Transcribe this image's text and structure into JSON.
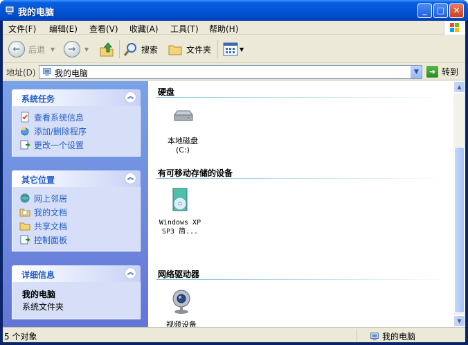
{
  "window": {
    "title": "我的电脑"
  },
  "menu": [
    "文件(F)",
    "编辑(E)",
    "查看(V)",
    "收藏(A)",
    "工具(T)",
    "帮助(H)"
  ],
  "toolbar": {
    "back_label": "后退",
    "search_label": "搜索",
    "folders_label": "文件夹"
  },
  "address": {
    "label": "地址(D)",
    "value": "我的电脑",
    "go_label": "转到"
  },
  "sidebar": {
    "system_tasks": {
      "title": "系统任务",
      "items": [
        "查看系统信息",
        "添加/删除程序",
        "更改一个设置"
      ]
    },
    "other_places": {
      "title": "其它位置",
      "items": [
        "网上邻居",
        "我的文档",
        "共享文档",
        "控制面板"
      ]
    },
    "details": {
      "title": "详细信息",
      "name": "我的电脑",
      "type": "系统文件夹"
    }
  },
  "groups": [
    {
      "title": "硬盘",
      "items": [
        {
          "line1": "本地磁盘",
          "line2": "(C:)"
        }
      ]
    },
    {
      "title": "有可移动存储的设备",
      "items": [
        {
          "line1": "Windows XP",
          "line2": "SP3 简..."
        }
      ]
    },
    {
      "title": "网络驱动器",
      "items": [
        {
          "line1": "视频设备",
          "line2": ""
        }
      ]
    }
  ],
  "status": {
    "left": "5 个对象",
    "right": "我的电脑"
  }
}
